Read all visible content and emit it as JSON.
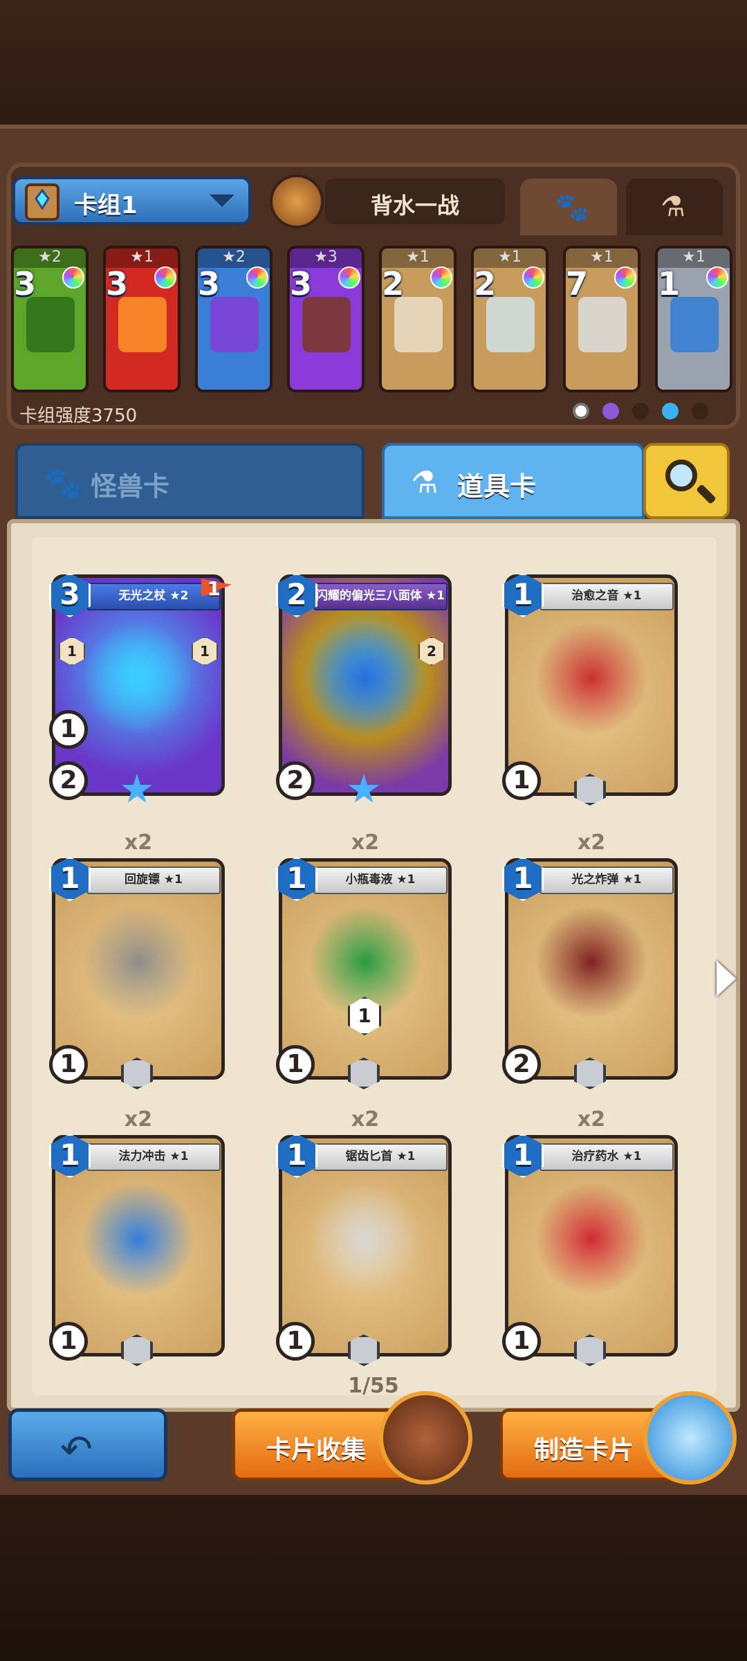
{
  "deck": {
    "name": "卡组1",
    "hero_name": "背水一战",
    "strength_label": "卡组强度3750",
    "tabs_small": [
      "paw-icon",
      "flask-icon"
    ],
    "cards": [
      {
        "cost": "3",
        "stars": "★2",
        "color": "#5ea62a",
        "art": "#2b6b1a"
      },
      {
        "cost": "3",
        "stars": "★1",
        "color": "#d22a22",
        "art": "#ff9a2a"
      },
      {
        "cost": "3",
        "stars": "★2",
        "color": "#3a7ed8",
        "art": "#8a3ad8"
      },
      {
        "cost": "3",
        "stars": "★3",
        "color": "#8a3ad8",
        "art": "#7a3a1a"
      },
      {
        "cost": "2",
        "stars": "★1",
        "color": "#c89c5c",
        "art": "#ede2cf"
      },
      {
        "cost": "2",
        "stars": "★1",
        "color": "#c89c5c",
        "art": "#cfe6ee"
      },
      {
        "cost": "7",
        "stars": "★1",
        "color": "#c89c5c",
        "art": "#dfe3e8"
      },
      {
        "cost": "1",
        "stars": "★1",
        "color": "#9aa3ad",
        "art": "#2a7ad8"
      }
    ]
  },
  "tabs": {
    "monster_label": "怪兽卡",
    "item_label": "道具卡"
  },
  "collection": {
    "cards": [
      {
        "title": "无光之杖 ★2",
        "cost": "3",
        "qty": "",
        "stat": "2",
        "stat2": "1",
        "flag": "1",
        "side_l": "1",
        "side_r": "1",
        "center": "",
        "type": "special",
        "art": "#3ad0ff"
      },
      {
        "title": "闪耀的偏光三八面体 ★1",
        "cost": "2",
        "qty": "",
        "stat": "2",
        "stat2": "",
        "flag": "",
        "side_l": "",
        "side_r": "2",
        "center": "",
        "type": "special2",
        "art": "#2a6ad8"
      },
      {
        "title": "治愈之音 ★1",
        "cost": "1",
        "qty": "",
        "stat": "1",
        "stat2": "",
        "flag": "",
        "side_l": "",
        "side_r": "",
        "center": "",
        "type": "normal",
        "art": "#c8282e"
      },
      {
        "title": "回旋镖 ★1",
        "cost": "1",
        "qty": "x2",
        "stat": "1",
        "stat2": "",
        "flag": "",
        "side_l": "",
        "side_r": "",
        "center": "",
        "type": "normal",
        "art": "#8a8a8a"
      },
      {
        "title": "小瓶毒液 ★1",
        "cost": "1",
        "qty": "x2",
        "stat": "1",
        "stat2": "",
        "flag": "",
        "side_l": "",
        "side_r": "",
        "center": "1",
        "type": "normal",
        "art": "#1e9a3e"
      },
      {
        "title": "光之炸弹 ★1",
        "cost": "1",
        "qty": "x2",
        "stat": "2",
        "stat2": "",
        "flag": "",
        "side_l": "",
        "side_r": "",
        "center": "",
        "type": "normal",
        "art": "#7a1a1a"
      },
      {
        "title": "法力冲击 ★1",
        "cost": "1",
        "qty": "x2",
        "stat": "1",
        "stat2": "",
        "flag": "",
        "side_l": "",
        "side_r": "",
        "center": "",
        "type": "normal",
        "art": "#2a7ae0"
      },
      {
        "title": "锯齿匕首 ★1",
        "cost": "1",
        "qty": "x2",
        "stat": "1",
        "stat2": "",
        "flag": "",
        "side_l": "",
        "side_r": "",
        "center": "",
        "type": "normal",
        "art": "#d8d8d8"
      },
      {
        "title": "治疗药水 ★1",
        "cost": "1",
        "qty": "x2",
        "stat": "1",
        "stat2": "",
        "flag": "",
        "side_l": "",
        "side_r": "",
        "center": "",
        "type": "normal",
        "art": "#d0222e"
      }
    ],
    "page_indicator": "1/55"
  },
  "buttons": {
    "collect_label": "卡片收集",
    "craft_label": "制造卡片"
  },
  "icons": {
    "back": "back-arrow-icon",
    "search": "search-icon",
    "next": "next-page-icon"
  },
  "colors": {
    "accent_blue": "#5fb3ee",
    "accent_orange": "#e26b12",
    "parchment": "#eee4cf"
  }
}
